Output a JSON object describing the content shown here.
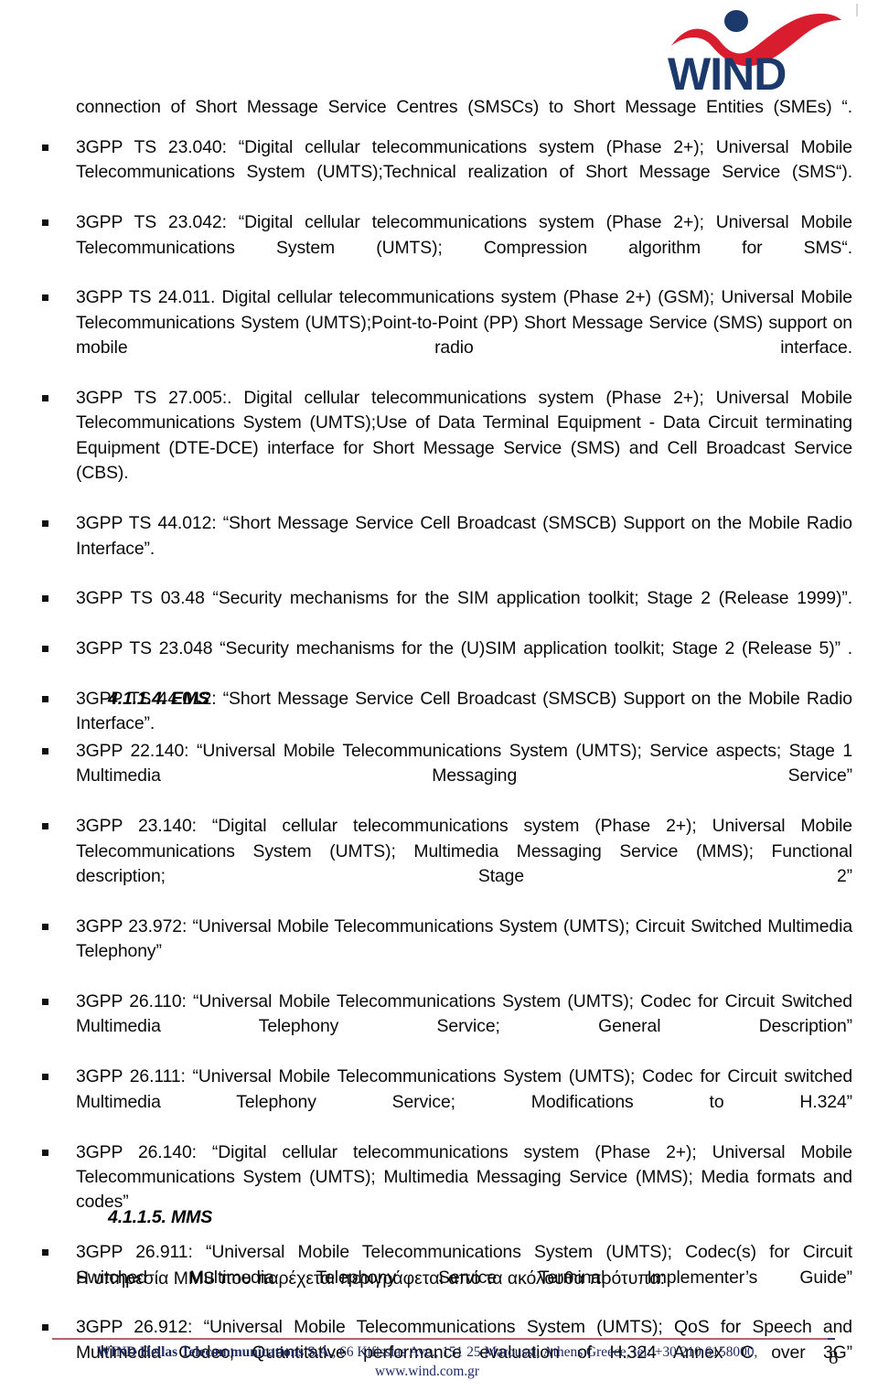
{
  "document": {
    "page_number": "8"
  },
  "logo": {
    "wordmark": "WIND",
    "red": "#D81E2E",
    "navy": "#1B3A6B"
  },
  "continuation_paragraph": "connection of Short Message Service Centres (SMSCs) to Short Message Entities (SMEs) “.",
  "sms_list": [
    "3GPP TS 23.040: “Digital cellular telecommunications system (Phase 2+); Universal Mobile Telecommunications System (UMTS);Technical realization of Short Message Service (SMS“).",
    "3GPP TS 23.042: “Digital cellular telecommunications system (Phase 2+); Universal Mobile Telecommunications System (UMTS); Compression algorithm for SMS“.",
    "3GPP TS 24.011. Digital cellular telecommunications system (Phase 2+) (GSM); Universal Mobile Telecommunications System (UMTS);Point-to-Point (PP) Short Message Service (SMS) support on mobile radio interface.",
    "3GPP TS 27.005:. Digital cellular telecommunications system (Phase 2+); Universal Mobile Telecommunications System (UMTS);Use of Data Terminal Equipment - Data Circuit terminating Equipment (DTE-DCE) interface for Short Message Service (SMS) and Cell Broadcast Service (CBS).",
    "3GPP TS 44.012: “Short Message Service Cell Broadcast (SMSCB) Support on the Mobile Radio Interface”.",
    "3GPP TS 03.48 “Security mechanisms for the SIM application toolkit; Stage 2 (Release 1999)”.",
    "3GPP TS 23.048 “Security mechanisms for the (U)SIM application toolkit; Stage 2 (Release 5)” .",
    "3GPP TS 44.012: “Short Message Service Cell Broadcast (SMSCB) Support on the Mobile Radio Interface”."
  ],
  "ems_section": {
    "heading": "4.1.1.4. EMS",
    "items": [
      "3GPP 22.140: “Universal Mobile Telecommunications System (UMTS); Service aspects; Stage 1 Multimedia Messaging Service”",
      "3GPP 23.140: “Digital cellular telecommunications system (Phase 2+); Universal Mobile Telecommunications System (UMTS); Multimedia Messaging Service (MMS); Functional description; Stage 2”",
      "3GPP 23.972: “Universal Mobile Telecommunications System (UMTS); Circuit Switched Multimedia Telephony”",
      "3GPP 26.110: “Universal Mobile Telecommunications System (UMTS); Codec for Circuit Switched Multimedia Telephony Service; General Description”",
      "3GPP 26.111: “Universal Mobile Telecommunications System (UMTS); Codec for Circuit switched Multimedia Telephony Service; Modifications to H.324”",
      "3GPP 26.140: “Digital cellular telecommunications system (Phase 2+); Universal Mobile Telecommunications System (UMTS); Multimedia Messaging Service (MMS); Media formats and codes”",
      "3GPP 26.911: “Universal Mobile Telecommunications System (UMTS); Codec(s) for Circuit Switched Multimedia Telephony Service Terminal Implementer’s Guide”",
      "3GPP 26.912: “Universal Mobile Telecommunications System (UMTS); QoS for Speech and Multimedia Codec; Quantitative performance evaluation of H.324 Annex C over 3G”"
    ]
  },
  "mms_section": {
    "heading": "4.1.1.5. MMS",
    "intro": "Η υπηρεσία MMS που παρέχεται περιγράφεται από τα ακόλουθα πρότυπα:"
  },
  "footer": {
    "company": "WIND Hellas Telecommunications S.A.",
    "address": ", 66 Kifissias Ave., 151 25 Maroussi, Athens Greece, tel: +30 210 6158000,",
    "url": "www.wind.com.gr",
    "rule_color": "#B4636B",
    "text_color": "#1D2A63"
  }
}
